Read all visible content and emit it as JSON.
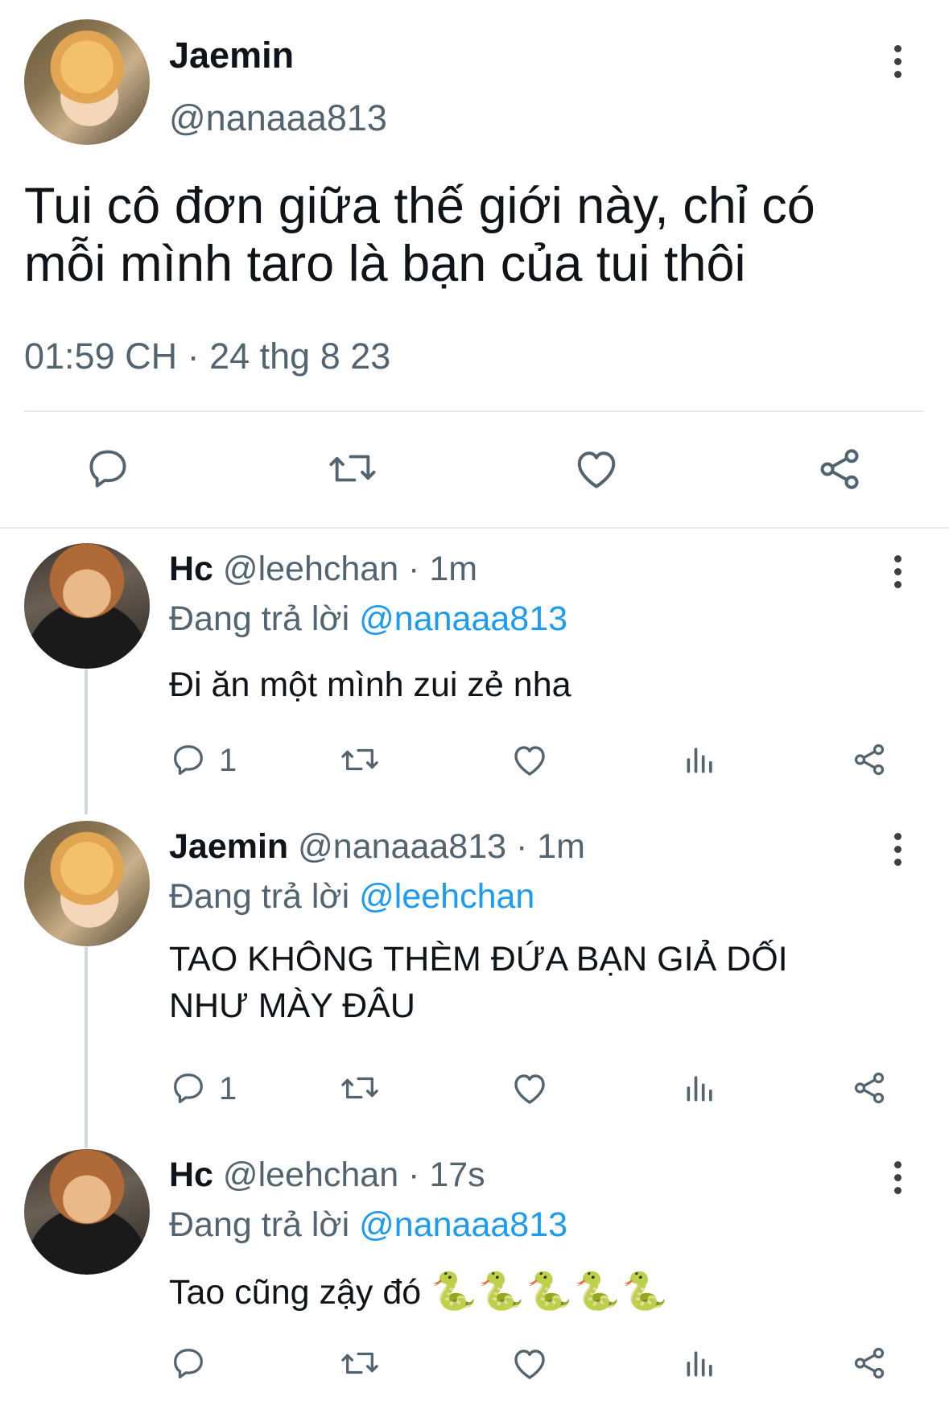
{
  "main_tweet": {
    "name": "Jaemin",
    "handle": "@nanaaa813",
    "text_line1": "Tui cô đơn giữa thế giới này, chỉ có",
    "text_line2": "mỗi mình taro là bạn của tui thôi",
    "timestamp": "01:59 CH · 24 thg 8 23"
  },
  "replies": [
    {
      "name": "Hc",
      "handle_time": "@leehchan · 1m",
      "replying_prefix": "Đang trả lời",
      "replying_to": "@nanaaa813",
      "text": "Đi ăn một mình zui zẻ nha",
      "reply_count": "1"
    },
    {
      "name": "Jaemin",
      "handle_time": "@nanaaa813 · 1m",
      "replying_prefix": "Đang trả lời",
      "replying_to": "@leehchan",
      "text_line1": "TAO KHÔNG THÈM ĐỨA BẠN GIẢ DỐI",
      "text_line2": "NHƯ MÀY ĐÂU",
      "reply_count": "1"
    },
    {
      "name": "Hc",
      "handle_time": "@leehchan · 17s",
      "replying_prefix": "Đang trả lời",
      "replying_to": "@nanaaa813",
      "text": "Tao cũng zậy đó",
      "emoji": "🐍🐍🐍🐍🐍"
    }
  ],
  "colors": {
    "mention": "#1d9bf0",
    "muted": "#536471",
    "text": "#0f1419"
  }
}
